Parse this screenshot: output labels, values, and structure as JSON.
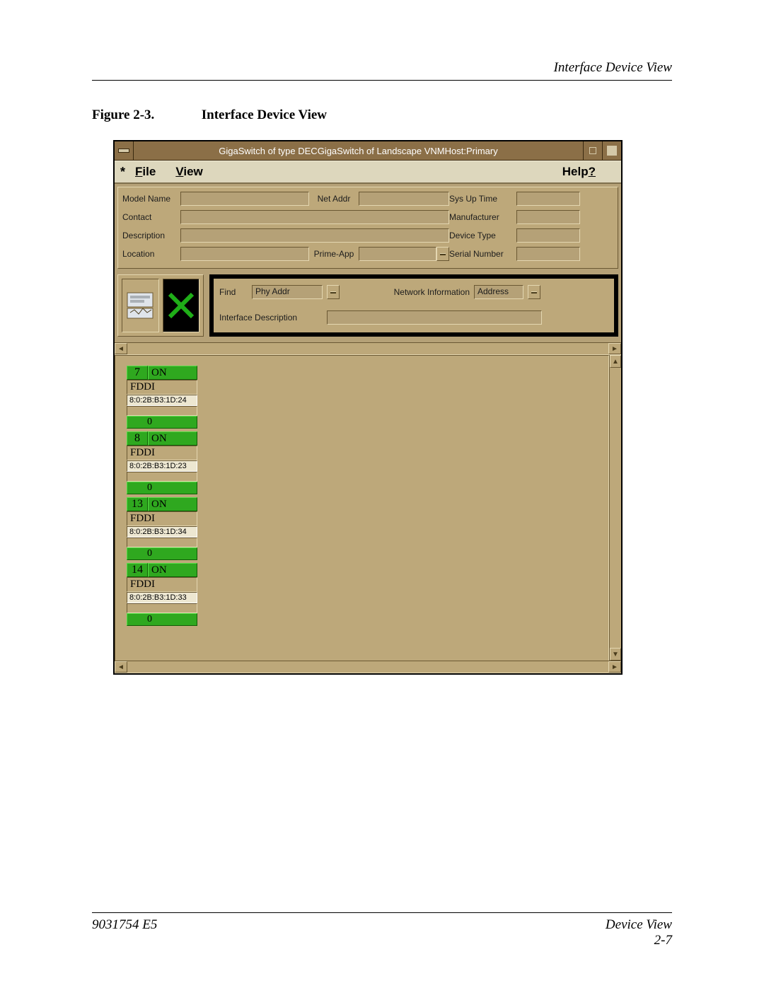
{
  "running_head": "Interface Device View",
  "figure": {
    "num": "Figure 2-3.",
    "title": "Interface Device View"
  },
  "window": {
    "title": "GigaSwitch of type DECGigaSwitch of Landscape VNMHost:Primary",
    "menu": {
      "star": "*",
      "file": "File",
      "view": "View",
      "help": "Help?"
    }
  },
  "info": {
    "model_name_lbl": "Model Name",
    "contact_lbl": "Contact",
    "description_lbl": "Description",
    "location_lbl": "Location",
    "net_addr_lbl": "Net Addr",
    "prime_app_lbl": "Prime-App",
    "sys_up_lbl": "Sys Up Time",
    "manufacturer_lbl": "Manufacturer",
    "device_type_lbl": "Device Type",
    "serial_lbl": "Serial Number"
  },
  "find_panel": {
    "find_lbl": "Find",
    "phy_addr_lbl": "Phy Addr",
    "net_info_lbl": "Network Information",
    "address_lbl": "Address",
    "if_desc_lbl": "Interface Description"
  },
  "interfaces": [
    {
      "num": "7",
      "state": "ON",
      "type": "FDDI",
      "mac": "8:0:2B:B3:1D:24",
      "zero": "0"
    },
    {
      "num": "8",
      "state": "ON",
      "type": "FDDI",
      "mac": "8:0:2B:B3:1D:23",
      "zero": "0"
    },
    {
      "num": "13",
      "state": "ON",
      "type": "FDDI",
      "mac": "8:0:2B:B3:1D:34",
      "zero": "0"
    },
    {
      "num": "14",
      "state": "ON",
      "type": "FDDI",
      "mac": "8:0:2B:B3:1D:33",
      "zero": "0"
    }
  ],
  "footer": {
    "doc_id": "9031754 E5",
    "section": "Device View",
    "page": "2-7"
  }
}
